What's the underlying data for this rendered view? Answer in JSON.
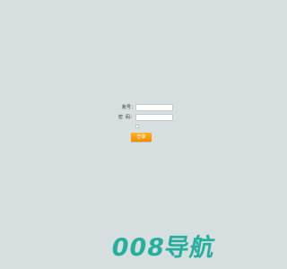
{
  "form": {
    "account_label": "账号：",
    "password_label": "密  码：",
    "account_value": "",
    "password_value": "",
    "login_button_label": "登录"
  },
  "watermark": {
    "text": "008导航"
  },
  "colors": {
    "background": "#d7dee0",
    "button": "#f28b00",
    "watermark": "#1bac98"
  }
}
